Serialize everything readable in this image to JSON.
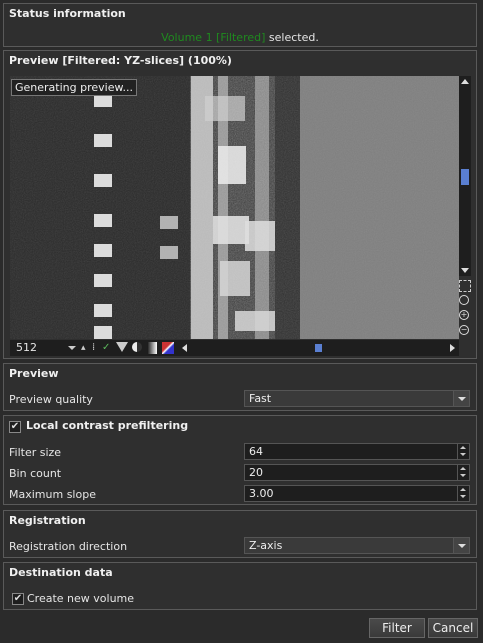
{
  "status": {
    "title": "Status information",
    "volume_name": "Volume 1 [Filtered]",
    "suffix": "selected."
  },
  "preview_panel": {
    "title": "Preview [Filtered: YZ-slices] (100%)",
    "overlay_label": "Generating preview...",
    "slice_value": "512"
  },
  "preview_group": {
    "title": "Preview",
    "quality_label": "Preview quality",
    "quality_value": "Fast"
  },
  "local_contrast": {
    "title": "Local contrast prefiltering",
    "checked": true,
    "filter_size_label": "Filter size",
    "filter_size_value": "64",
    "bin_count_label": "Bin count",
    "bin_count_value": "20",
    "max_slope_label": "Maximum slope",
    "max_slope_value": "3.00"
  },
  "registration": {
    "title": "Registration",
    "direction_label": "Registration direction",
    "direction_value": "Z-axis"
  },
  "destination": {
    "title": "Destination data",
    "create_new_label": "Create new volume",
    "checked": true
  },
  "buttons": {
    "filter": "Filter",
    "cancel": "Cancel"
  },
  "colors": {
    "volume_text": "#1f8a1f",
    "background": "#2b2b2b"
  },
  "icons": [
    "spin-icon",
    "line-tool-icon",
    "filter-icon",
    "circle-icon",
    "gradient-icon",
    "color-map-icon",
    "fit-view-icon",
    "zoom-icon",
    "zoom-in-icon",
    "zoom-out-icon"
  ]
}
